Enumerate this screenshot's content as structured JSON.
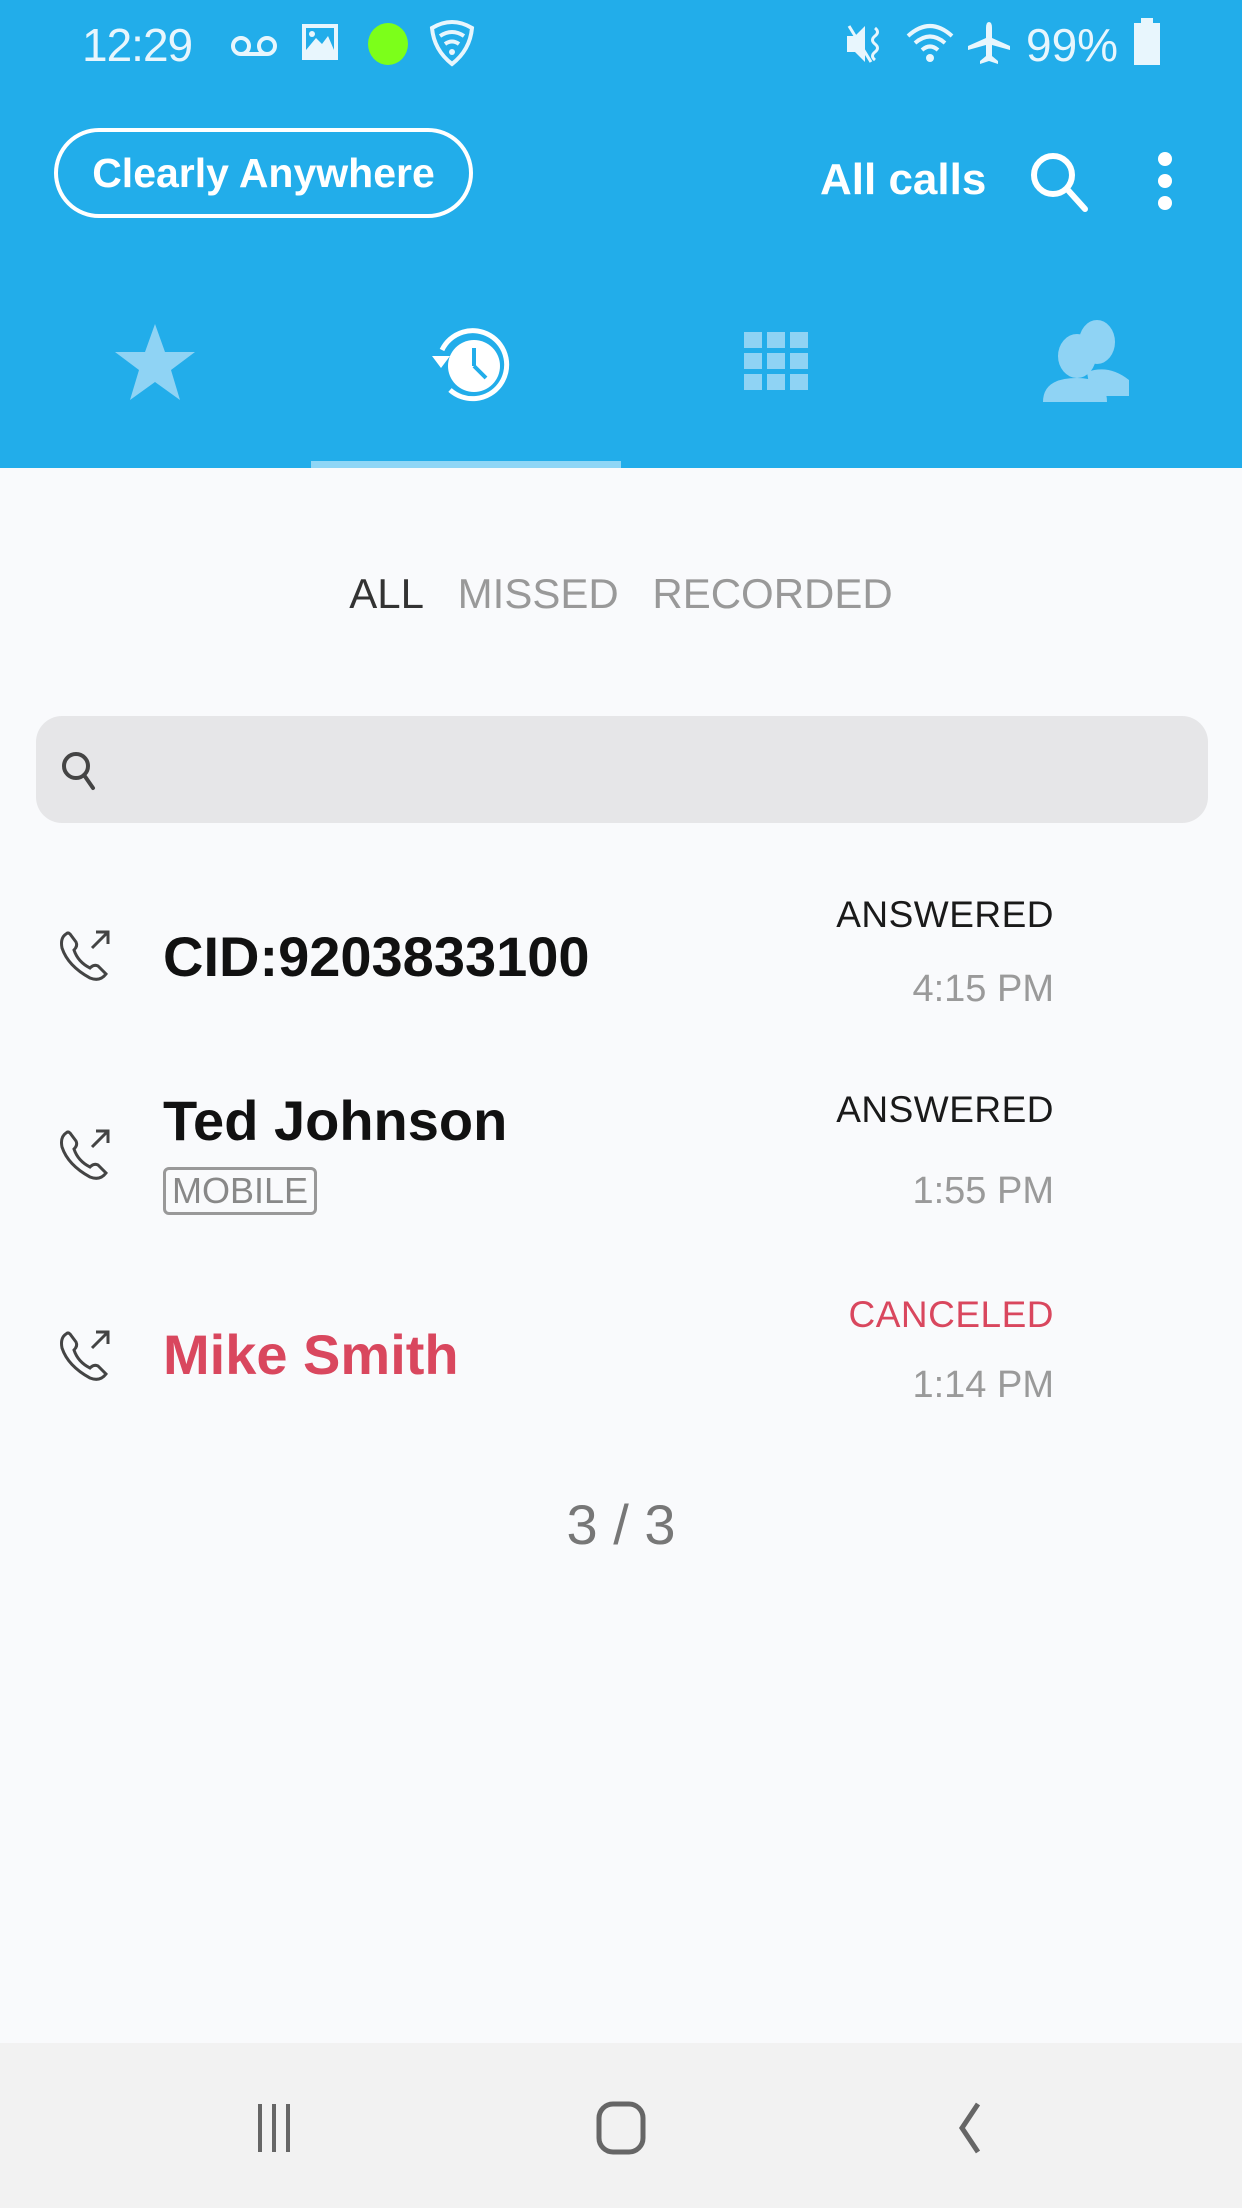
{
  "status_bar": {
    "time": "12:29",
    "left_icons": [
      "voicemail-icon",
      "image-icon",
      "green-dot-icon",
      "vpn-shield-icon"
    ],
    "right_icons": [
      "vibrate-mute-icon",
      "wifi-icon",
      "airplane-icon",
      "battery-icon"
    ],
    "battery": "99%"
  },
  "header": {
    "brand": "Clearly Anywhere",
    "filter_label": "All calls",
    "icons": [
      "search-icon",
      "more-vert-icon"
    ]
  },
  "tabs": [
    {
      "name": "favorites",
      "icon": "star-icon",
      "active": false
    },
    {
      "name": "recents",
      "icon": "history-clock-icon",
      "active": true
    },
    {
      "name": "keypad",
      "icon": "dialpad-icon",
      "active": false
    },
    {
      "name": "contacts",
      "icon": "contacts-icon",
      "active": false
    }
  ],
  "subfilters": [
    {
      "label": "ALL",
      "active": true
    },
    {
      "label": "MISSED",
      "active": false
    },
    {
      "label": "RECORDED",
      "active": false
    }
  ],
  "search": {
    "placeholder": "",
    "value": ""
  },
  "calls": [
    {
      "name": "CID:9203833100",
      "tag": "",
      "status": "ANSWERED",
      "time": "4:15 PM",
      "direction": "outgoing",
      "missed": false
    },
    {
      "name": "Ted Johnson",
      "tag": "MOBILE",
      "status": "ANSWERED",
      "time": "1:55 PM",
      "direction": "outgoing",
      "missed": false
    },
    {
      "name": "Mike Smith",
      "tag": "",
      "status": "CANCELED",
      "time": "1:14 PM",
      "direction": "outgoing",
      "missed": true
    }
  ],
  "pagination": "3 / 3",
  "colors": {
    "header_bg": "#22adea",
    "missed": "#d9475e",
    "status_dot": "#7cff1a"
  },
  "nav": [
    "recent-apps-icon",
    "home-icon",
    "back-icon"
  ]
}
